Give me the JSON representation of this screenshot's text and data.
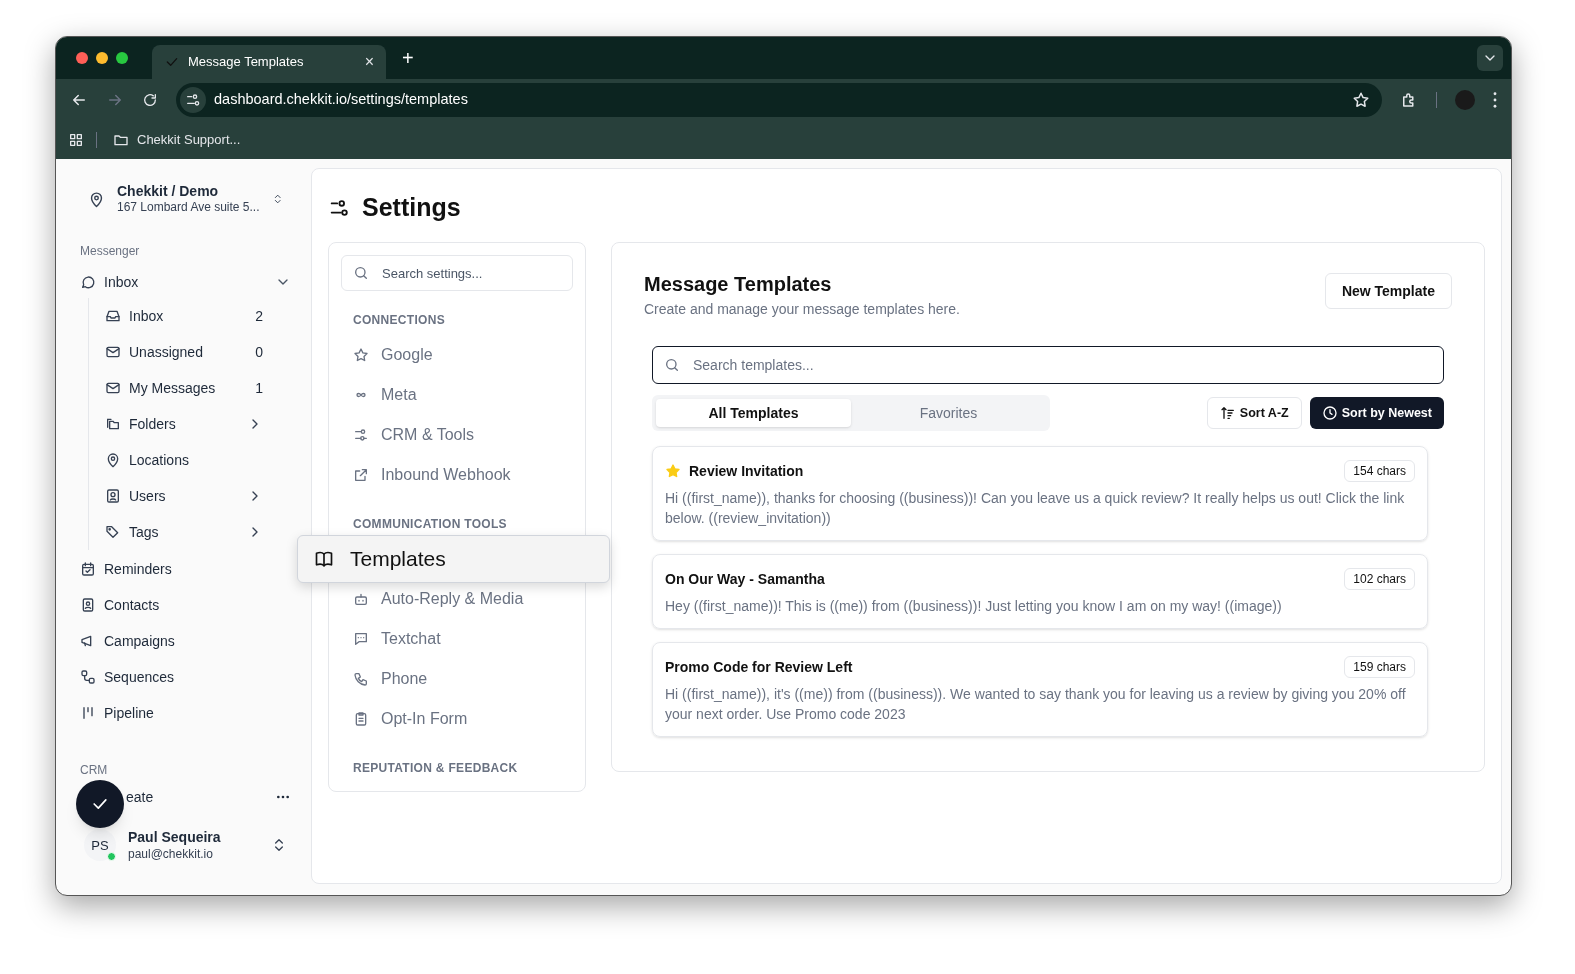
{
  "browser": {
    "tab_title": "Message Templates",
    "tab_close": "×",
    "new_tab": "+",
    "url": "dashboard.chekkit.io/settings/templates",
    "bookmark": "Chekkit Support..."
  },
  "sidebar": {
    "workspace": {
      "name": "Chekkit / Demo",
      "address": "167 Lombard Ave suite 5..."
    },
    "section_label": "Messenger",
    "group": {
      "label": "Inbox",
      "expanded": true,
      "children": [
        {
          "label": "Inbox",
          "count": "2",
          "submenu": false
        },
        {
          "label": "Unassigned",
          "count": "0",
          "submenu": false
        },
        {
          "label": "My Messages",
          "count": "1",
          "submenu": false
        },
        {
          "label": "Folders",
          "submenu": true
        },
        {
          "label": "Locations",
          "submenu": false
        },
        {
          "label": "Users",
          "submenu": true
        },
        {
          "label": "Tags",
          "submenu": true
        }
      ]
    },
    "items": [
      {
        "label": "Reminders"
      },
      {
        "label": "Contacts"
      },
      {
        "label": "Campaigns"
      },
      {
        "label": "Sequences"
      },
      {
        "label": "Pipeline"
      }
    ],
    "crm_label": "CRM",
    "crm_item": "eate",
    "user": {
      "initials": "PS",
      "name": "Paul Sequeira",
      "email": "paul@chekkit.io",
      "online": true
    }
  },
  "settings": {
    "title": "Settings",
    "search_placeholder": "Search settings...",
    "sections": [
      {
        "heading": "CONNECTIONS",
        "items": [
          {
            "label": "Google",
            "dragging": false
          },
          {
            "label": "Meta",
            "dragging": false
          },
          {
            "label": "CRM & Tools",
            "dragging": false
          },
          {
            "label": "Inbound Webhook",
            "dragging": false
          }
        ]
      },
      {
        "heading": "COMMUNICATION TOOLS",
        "items": [
          {
            "label": "Templates",
            "dragging": true
          },
          {
            "label": "Auto-Reply & Media",
            "dragging": false
          },
          {
            "label": "Textchat",
            "dragging": false
          },
          {
            "label": "Phone",
            "dragging": false
          },
          {
            "label": "Opt-In Form",
            "dragging": false
          }
        ]
      },
      {
        "heading": "REPUTATION & FEEDBACK"
      }
    ]
  },
  "templates": {
    "title": "Message Templates",
    "subtitle": "Create and manage your message templates here.",
    "new_button": "New Template",
    "search_placeholder": "Search templates...",
    "tabs": [
      {
        "label": "All Templates",
        "selected": true
      },
      {
        "label": "Favorites",
        "selected": false
      }
    ],
    "sorts": [
      {
        "label": "Sort A-Z",
        "selected": false
      },
      {
        "label": "Sort by Newest",
        "selected": true
      }
    ],
    "list": [
      {
        "title": "Review Invitation",
        "favorite": true,
        "chars": "154 chars",
        "body": "Hi ((first_name)), thanks for choosing ((business))! Can you leave us a quick review? It really helps us out! Click the link below. ((review_invitation))"
      },
      {
        "title": "On Our Way - Samantha",
        "favorite": false,
        "chars": "102 chars",
        "body": "Hey ((first_name))! This is ((me)) from ((business))! Just letting you know I am on my way!  ((image))"
      },
      {
        "title": "Promo Code for Review Left",
        "favorite": false,
        "chars": "159 chars",
        "body": "Hi ((first_name)), it's ((me)) from ((business)). We wanted to say thank you for leaving us a review by giving you 20% off your next order. Use Promo code 2023"
      }
    ]
  }
}
